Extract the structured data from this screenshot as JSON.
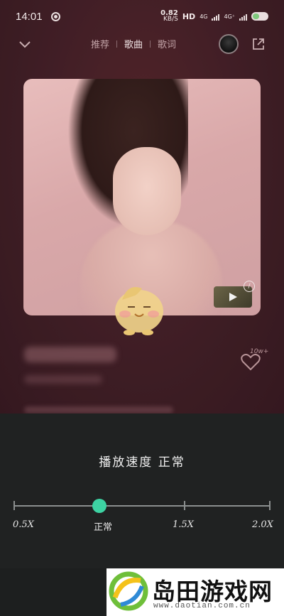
{
  "status_bar": {
    "time": "14:01",
    "net_speed": "0.82",
    "net_unit": "KB/S",
    "hd_label": "HD",
    "network_1": "4G",
    "network_2": "4G⁺"
  },
  "top_bar": {
    "tabs": [
      {
        "label": "推荐",
        "active": false
      },
      {
        "label": "歌曲",
        "active": true
      },
      {
        "label": "歌词",
        "active": false
      }
    ]
  },
  "player": {
    "like_count": "10w+"
  },
  "speed_sheet": {
    "title": "播放速度 正常",
    "options": [
      "0.5X",
      "正常",
      "1.5X",
      "2.0X"
    ],
    "selected": "正常",
    "accent_color": "#3dd3a3"
  },
  "watermark": {
    "name": "岛田游戏网",
    "url": "www.daotian.com.cn"
  }
}
